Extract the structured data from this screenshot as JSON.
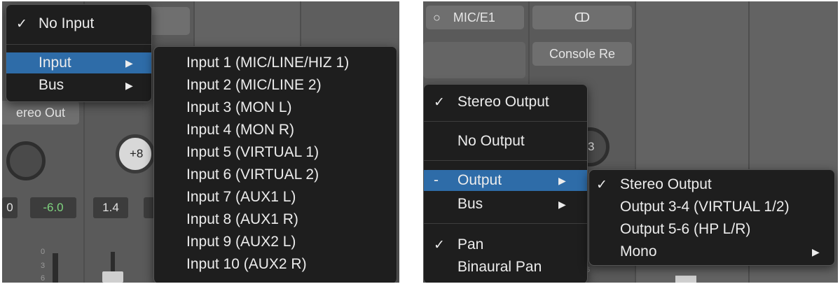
{
  "left": {
    "strip_label": "ereo Out",
    "knob_value": "+8",
    "values": [
      "0",
      "-6.0",
      "1.4"
    ],
    "meter_ticks": [
      "0",
      "3",
      "6"
    ],
    "menu": {
      "no_input": "No Input",
      "input": "Input",
      "bus": "Bus"
    },
    "submenu": [
      "Input 1  (MIC/LINE/HIZ 1)",
      "Input 2  (MIC/LINE 2)",
      "Input 3  (MON L)",
      "Input 4  (MON R)",
      "Input 5  (VIRTUAL 1)",
      "Input 6  (VIRTUAL 2)",
      "Input 7  (AUX1 L)",
      "Input 8  (AUX1 R)",
      "Input 9  (AUX2 L)",
      "Input 10  (AUX2 R)"
    ]
  },
  "right": {
    "input_button": "MIC/E1",
    "link_icon_glyph": "ↀ",
    "console_button": "Console Re",
    "knob_partial": "3",
    "meter_ticks": [
      "6"
    ],
    "menu": {
      "stereo_output": "Stereo Output",
      "no_output": "No Output",
      "output_dash": "-",
      "output": "Output",
      "bus": "Bus",
      "pan": "Pan",
      "binaural_pan": "Binaural Pan"
    },
    "submenu": {
      "stereo_output": "Stereo Output",
      "output_3_4": "Output 3-4  (VIRTUAL 1/2)",
      "output_5_6": "Output 5-6  (HP L/R)",
      "mono": "Mono"
    }
  },
  "glyphs": {
    "check": "✓",
    "arrow": "▶",
    "circle": "○"
  },
  "colors": {
    "highlight": "#2e6ca8",
    "menu_bg": "#1e1e1e",
    "value_green": "#7fd37f"
  }
}
